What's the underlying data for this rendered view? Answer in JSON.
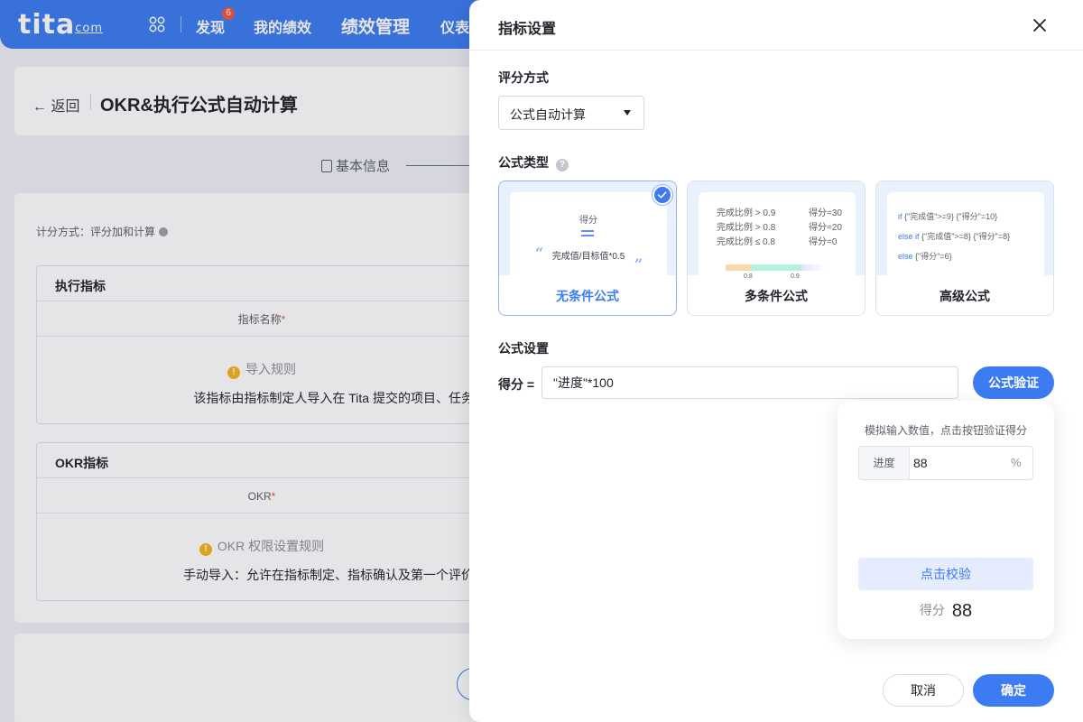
{
  "topbar": {
    "logo": "tita",
    "logo_suffix": "com",
    "nav_items": [
      "发现",
      "我的绩效",
      "绩效管理",
      "仪表"
    ],
    "discover_badge": "6",
    "brand_color": "#3c7bf1"
  },
  "page": {
    "back_label": "返回",
    "title": "OKR&执行公式自动计算",
    "step_label": "基本信息",
    "calc_method": "计分方式：评分加和计算",
    "exec_section": {
      "title": "执行指标",
      "column_header": "指标名称",
      "rule_title": "导入规则",
      "rule_text": "该指标由指标制定人导入在 Tita 提交的项目、任务"
    },
    "okr_section": {
      "title": "OKR指标",
      "column_header": "OKR",
      "rule_title": "OKR 权限设置规则",
      "rule_text": "手动导入：允许在指标制定、指标确认及第一个评价"
    }
  },
  "drawer": {
    "title": "指标设置",
    "scoring_label": "评分方式",
    "scoring_value": "公式自动计算",
    "formula_type_label": "公式类型",
    "formula_types": [
      {
        "label": "无条件公式",
        "selected": true,
        "preview_title": "得分",
        "preview_formula": "完成值/目标值*0.5"
      },
      {
        "label": "多条件公式",
        "selected": false,
        "rows": [
          {
            "cond": "完成比例 > 0.9",
            "score": "得分=30"
          },
          {
            "cond": "完成比例 > 0.8",
            "score": "得分=20"
          },
          {
            "cond": "完成比例 ≤ 0.8",
            "score": "得分=0"
          }
        ],
        "ticks": [
          "0.8",
          "0.9"
        ]
      },
      {
        "label": "高级公式",
        "selected": false,
        "lines": [
          {
            "kw": "if",
            "rest": " {\"完成值\">=9} {\"得分\"=10}"
          },
          {
            "kw": "else if",
            "rest": " {\"完成值\">=8} {\"得分\"=8}"
          },
          {
            "kw": "else",
            "rest": " {\"得分\"=6}"
          }
        ]
      }
    ],
    "formula_settings_label": "公式设置",
    "formula_prefix": "得分 =",
    "formula_value": "\"进度\"*100",
    "verify_button": "公式验证",
    "popover": {
      "hint": "模拟输入数值，点击按钮验证得分",
      "addon": "进度",
      "value": "88",
      "unit": "%",
      "check_button": "点击校验",
      "score_label": "得分",
      "score_value": "88"
    },
    "cancel_button": "取消",
    "confirm_button": "确定"
  }
}
